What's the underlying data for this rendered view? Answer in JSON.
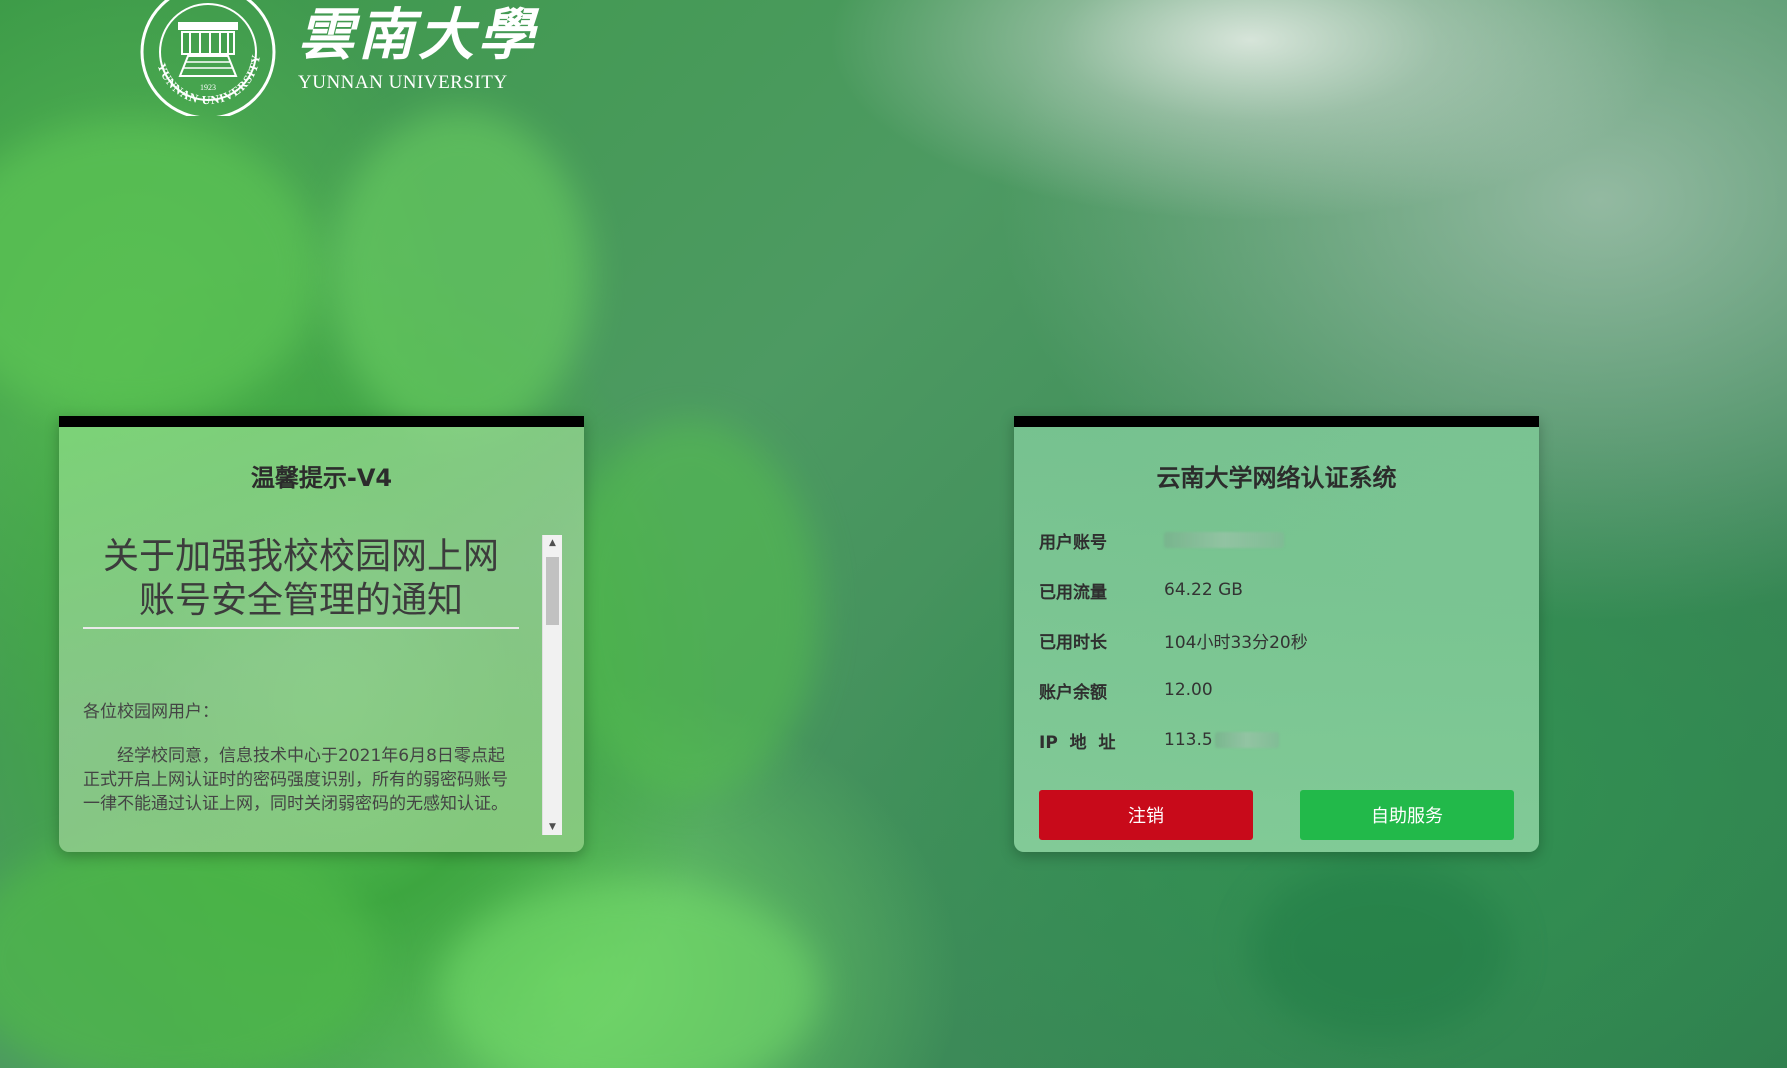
{
  "logo": {
    "cn_name": "雲南大學",
    "en_name": "YUNNAN UNIVERSITY",
    "seal_text": "YUNNAN UNIVERSITY",
    "seal_year": "1923"
  },
  "notice_panel": {
    "title": "温馨提示-V4",
    "heading": "关于加强我校校园网上网账号安全管理的通知",
    "greeting": "各位校园网用户：",
    "body": "经学校同意，信息技术中心于2021年6月8日零点起正式开启上网认证时的密码强度识别，所有的弱密码账号一律不能通过认证上网，同时关闭弱密码的无感知认证。"
  },
  "account_panel": {
    "title": "云南大学网络认证系统",
    "rows": [
      {
        "label": "用户账号",
        "value": ""
      },
      {
        "label": "已用流量",
        "value": "64.22 GB"
      },
      {
        "label": "已用时长",
        "value": "104小时33分20秒"
      },
      {
        "label": "账户余额",
        "value": "12.00"
      },
      {
        "label": "IP  地  址",
        "value": "113.5"
      }
    ],
    "buttons": {
      "logout": "注销",
      "self_service": "自助服务"
    }
  },
  "colors": {
    "logout_button": "#c80a1a",
    "self_service_button": "#22b94a",
    "panel_top_border": "#000000"
  }
}
